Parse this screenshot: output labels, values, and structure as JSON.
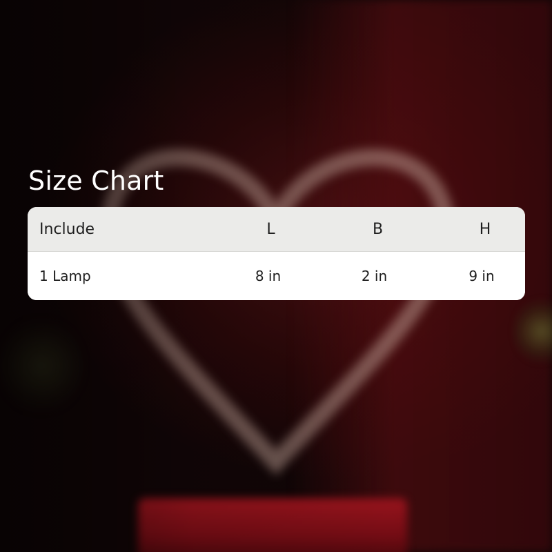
{
  "title": "Size Chart",
  "table": {
    "headers": [
      "Include",
      "L",
      "B",
      "H"
    ],
    "rows": [
      [
        "1 Lamp",
        "8 in",
        "2 in",
        "9 in"
      ]
    ]
  },
  "colors": {
    "background": "#120607",
    "title_text": "#ffffff",
    "header_bg": "#ebebe9",
    "row_bg": "#ffffff",
    "cell_text": "#1e1e1e"
  }
}
